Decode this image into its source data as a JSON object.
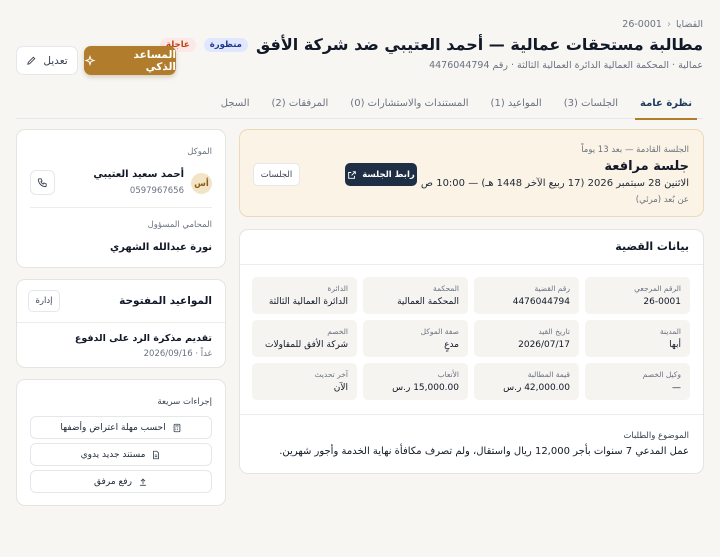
{
  "breadcrumb": {
    "root": "القضايا",
    "current": "26-0001"
  },
  "header": {
    "title": "مطالبة مستحقات عمالية — أحمد العتيبي ضد شركة الأفق",
    "badge_status": "منظورة",
    "badge_priority": "عاجلة",
    "subtitle": "عمالية · المحكمة العمالية الدائرة العمالية الثالثة · رقم 4476044794",
    "ai_button": "المساعد الذكي",
    "edit_button": "تعديل"
  },
  "tabs": [
    {
      "label": "نظرة عامة"
    },
    {
      "label": "الجلسات (3)"
    },
    {
      "label": "المواعيد (1)"
    },
    {
      "label": "المستندات والاستشارات (0)"
    },
    {
      "label": "المرفقات (2)"
    },
    {
      "label": "السجل"
    }
  ],
  "next_session": {
    "meta": "الجلسة القادمة — بعد 13 يوماً",
    "title": "جلسة مرافعة",
    "date": "الاثنين 28 سبتمبر 2026 (17 ربيع الآخر 1448 هـ) — 10:00 ص",
    "mode": "عن بُعد (مرئي)",
    "link_button": "رابط الجلسة",
    "sessions_button": "الجلسات"
  },
  "case_data": {
    "heading": "بيانات القضية",
    "fields": [
      {
        "key": "الرقم المرجعي",
        "value": "26-0001"
      },
      {
        "key": "رقم القضية",
        "value": "4476044794"
      },
      {
        "key": "المحكمة",
        "value": "المحكمة العمالية"
      },
      {
        "key": "الدائرة",
        "value": "الدائرة العمالية الثالثة"
      },
      {
        "key": "المدينة",
        "value": "أبها"
      },
      {
        "key": "تاريخ القيد",
        "value": "2026/07/17"
      },
      {
        "key": "صفة الموكل",
        "value": "مدعٍ"
      },
      {
        "key": "الخصم",
        "value": "شركة الأفق للمقاولات"
      },
      {
        "key": "وكيل الخصم",
        "value": "—"
      },
      {
        "key": "قيمة المطالبة",
        "value": "42,000.00 ر.س"
      },
      {
        "key": "الأتعاب",
        "value": "15,000.00 ر.س"
      },
      {
        "key": "آخر تحديث",
        "value": "الآن"
      }
    ],
    "subject_label": "الموضوع والطلبات",
    "subject_text": "عمل المدعي 7 سنوات بأجر 12,000 ريال واستقال، ولم تصرف مكافأة نهاية الخدمة وأجور شهرين."
  },
  "client": {
    "label": "الموكل",
    "avatar": "أس",
    "name": "أحمد سعيد العتيبي",
    "phone": "0597967656",
    "lawyer_label": "المحامي المسؤول",
    "lawyer_name": "نورة عبدالله الشهري"
  },
  "appointments": {
    "heading": "المواعيد المفتوحة",
    "manage_button": "إدارة",
    "item_title": "تقديم مذكرة الرد على الدفوع",
    "item_date": "غداً · 2026/09/16"
  },
  "quick_actions": {
    "heading": "إجراءات سريعة",
    "items": [
      {
        "label": "احسب مهلة اعتراض وأضفها"
      },
      {
        "label": "مستند جديد يدوي"
      },
      {
        "label": "رفع مرفق"
      }
    ]
  },
  "colors": {
    "accent": "#b17d2c",
    "navy": "#1e2f45",
    "background": "#f7f6f3"
  }
}
